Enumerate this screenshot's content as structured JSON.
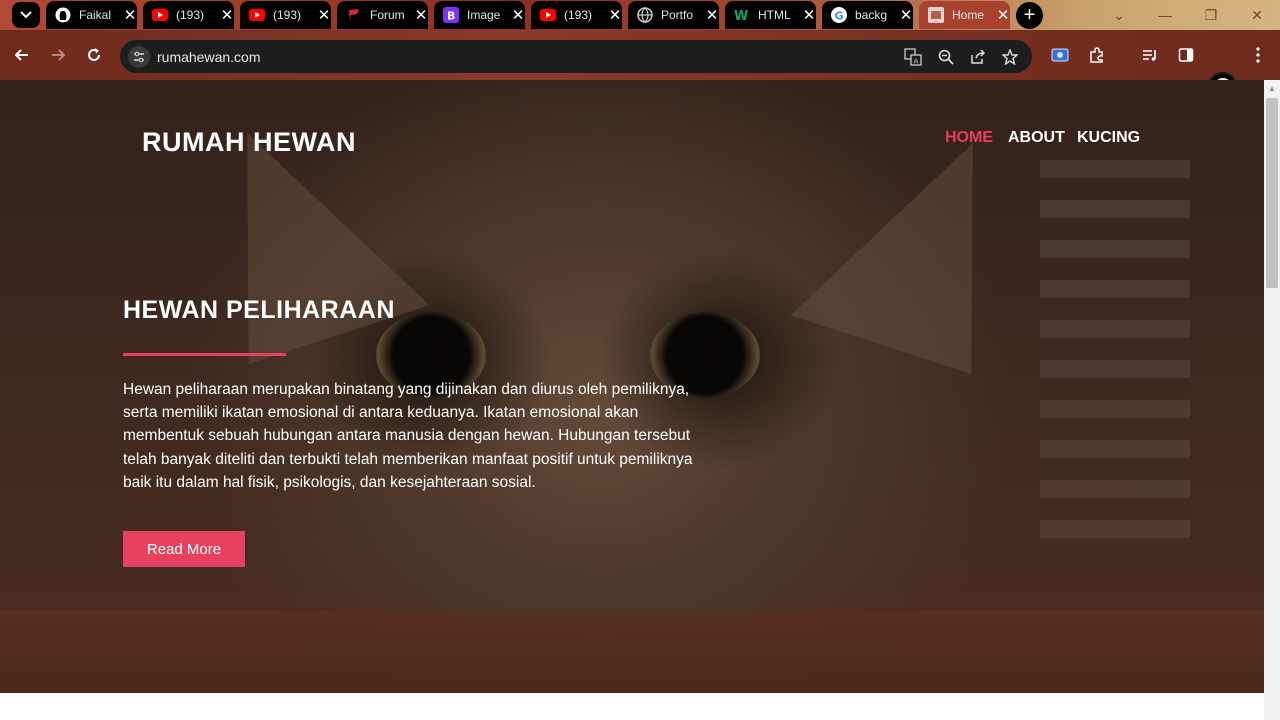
{
  "browser": {
    "tabs": [
      {
        "title": "Faikal",
        "icon": "github-icon"
      },
      {
        "title": "(193)",
        "icon": "youtube-icon"
      },
      {
        "title": "(193)",
        "icon": "youtube-icon"
      },
      {
        "title": "Forum",
        "icon": "forum-icon"
      },
      {
        "title": "Image",
        "icon": "bootstrap-icon"
      },
      {
        "title": "(193)",
        "icon": "youtube-icon"
      },
      {
        "title": "Portfo",
        "icon": "globe-icon"
      },
      {
        "title": "HTML",
        "icon": "w-icon"
      },
      {
        "title": "backg",
        "icon": "google-icon"
      },
      {
        "title": "Home",
        "icon": "page-icon",
        "active": true
      }
    ],
    "tab_close": "✕",
    "new_tab": "+",
    "address": "rumahewan.com",
    "colors": {
      "tab_bg": "#000000",
      "active_tab": "#a8412e",
      "omnibox": "#1e1d1d"
    }
  },
  "site": {
    "brand": "RUMAH HEWAN",
    "nav": [
      {
        "label": "HOME",
        "active": true
      },
      {
        "label": "ABOUT"
      },
      {
        "label": "KUCING"
      }
    ],
    "hero": {
      "title": "HEWAN PELIHARAAN",
      "body": "Hewan peliharaan merupakan binatang yang dijinakan dan diurus oleh pemiliknya, serta memiliki ikatan emosional di antara keduanya. Ikatan emosional akan membentuk sebuah hubungan antara manusia dengan hewan. Hubungan tersebut telah banyak diteliti dan terbukti telah memberikan manfaat positif untuk pemiliknya baik itu dalam hal fisik, psikologis, dan kesejahteraan sosial.",
      "button": "Read More",
      "background": "cat-photo"
    },
    "colors": {
      "accent": "#e8405f",
      "nav_active": "#ea3b62",
      "text": "#ffffff"
    }
  }
}
